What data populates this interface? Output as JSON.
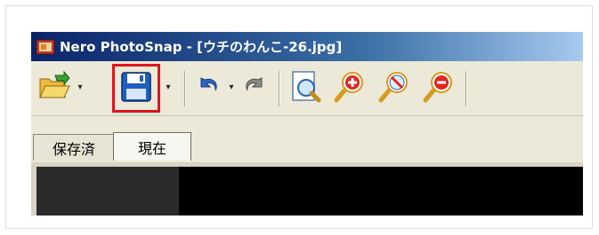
{
  "window": {
    "title": "Nero PhotoSnap - [ウチのわんこ-26.jpg]"
  },
  "toolbar": {
    "open_icon": "folder-open-icon",
    "save_icon": "floppy-disk-icon",
    "undo_icon": "undo-icon",
    "redo_icon": "redo-icon",
    "preview_icon": "page-preview-icon",
    "zoom_in_icon": "zoom-in-icon",
    "zoom_fit_icon": "zoom-fit-icon",
    "zoom_out_icon": "zoom-out-icon",
    "dropdown_glyph": "▾"
  },
  "tabs": [
    {
      "label": "保存済"
    },
    {
      "label": "現在"
    }
  ],
  "colors": {
    "highlight": "#e0141e",
    "title_bar": "#0a246a",
    "toolbar_bg": "#ece9d8"
  }
}
